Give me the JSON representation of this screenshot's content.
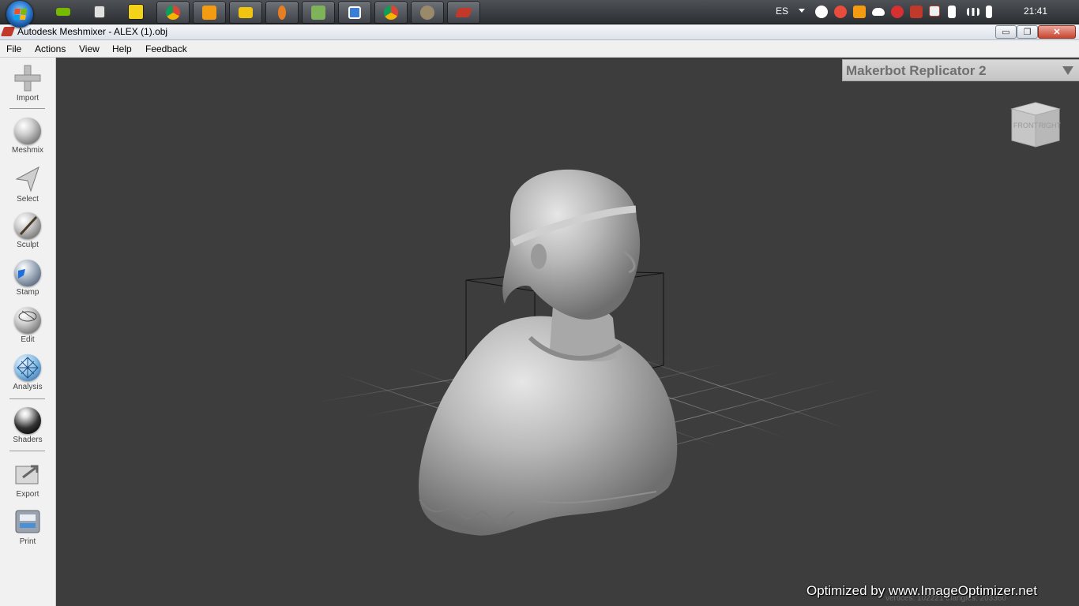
{
  "taskbar": {
    "start_label": "Start",
    "language": "ES",
    "clock": "21:41",
    "apps": [
      {
        "name": "nvidia-app-icon",
        "color": "#76b900"
      },
      {
        "name": "calculator-app-icon",
        "color": "#e0e0e0"
      },
      {
        "name": "notepad-plus-app-icon",
        "color": "#f3d21a"
      },
      {
        "name": "chrome-app-icon",
        "color": "#db4437"
      },
      {
        "name": "media-player-app-icon",
        "color": "#f39c12"
      },
      {
        "name": "file-explorer-app-icon",
        "color": "#f1c40f"
      },
      {
        "name": "meshmixer-pin-app-icon",
        "color": "#e67e22"
      },
      {
        "name": "photos-app-icon",
        "color": "#7fb35a"
      },
      {
        "name": "netbeans-app-icon",
        "color": "#3a7fd5"
      },
      {
        "name": "chrome-second-app-icon",
        "color": "#34a853"
      },
      {
        "name": "gimp-app-icon",
        "color": "#9a8a6a"
      },
      {
        "name": "meshmixer-active-app-icon",
        "color": "#c0392b"
      }
    ]
  },
  "window": {
    "title": "Autodesk Meshmixer - ALEX (1).obj",
    "minimize": "▭",
    "maximize": "❐",
    "close": "✕"
  },
  "menu": [
    "File",
    "Actions",
    "View",
    "Help",
    "Feedback"
  ],
  "tools": [
    {
      "label": "Import",
      "icon": "plus-icon"
    },
    {
      "label": "Meshmix",
      "icon": "meshmix-head-icon"
    },
    {
      "label": "Select",
      "icon": "select-arrow-icon"
    },
    {
      "label": "Sculpt",
      "icon": "sculpt-brush-icon"
    },
    {
      "label": "Stamp",
      "icon": "stamp-icon"
    },
    {
      "label": "Edit",
      "icon": "edit-sphere-icon"
    },
    {
      "label": "Analysis",
      "icon": "analysis-mesh-icon"
    },
    {
      "label": "Shaders",
      "icon": "shaders-sphere-icon"
    },
    {
      "label": "Export",
      "icon": "export-icon"
    },
    {
      "label": "Print",
      "icon": "print-icon"
    }
  ],
  "viewport": {
    "printer": "Makerbot Replicator 2",
    "viewcube_front": "FRONT",
    "viewcube_right": "RIGHT",
    "watermark": "Optimized by www.ImageOptimizer.net",
    "status_ghost": "vertices: 102221  triangles: 203360"
  },
  "colors": {
    "viewport_bg": "#3d3d3d",
    "toolbar_bg": "#f1f1f1",
    "model": "#b8b8b8"
  }
}
